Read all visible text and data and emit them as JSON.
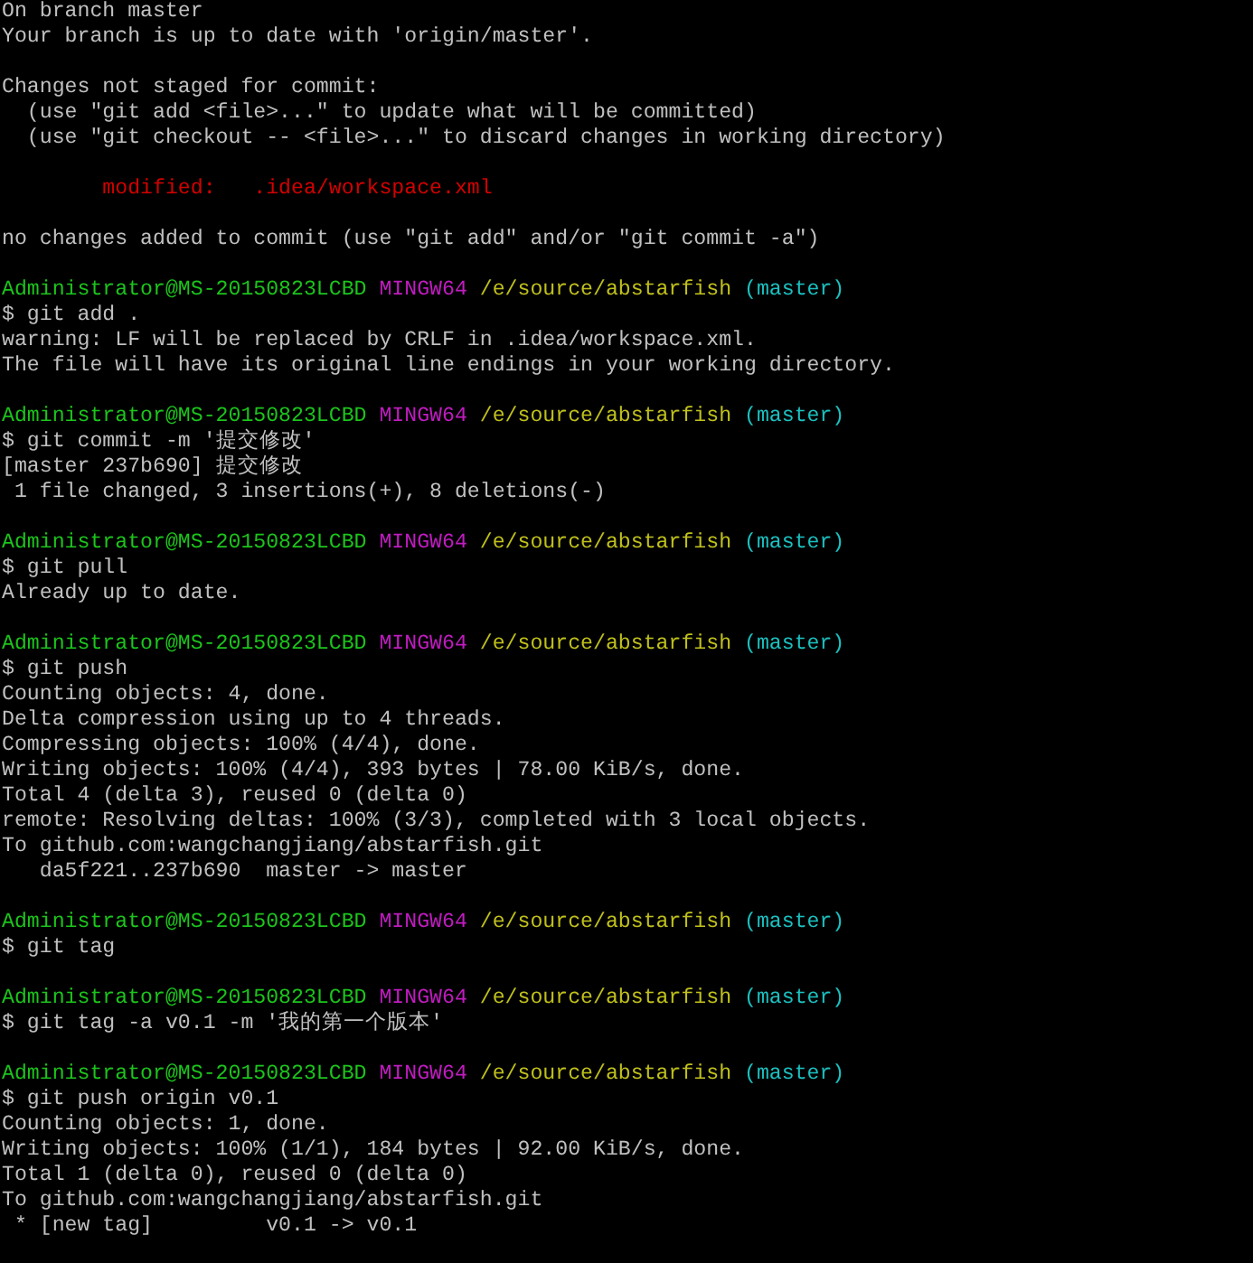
{
  "terminal": {
    "lines": [
      {
        "kind": "text",
        "text": "On branch master"
      },
      {
        "kind": "text",
        "text": "Your branch is up to date with 'origin/master'."
      },
      {
        "kind": "blank"
      },
      {
        "kind": "text",
        "text": "Changes not staged for commit:"
      },
      {
        "kind": "text",
        "text": "  (use \"git add <file>...\" to update what will be committed)"
      },
      {
        "kind": "text",
        "text": "  (use \"git checkout -- <file>...\" to discard changes in working directory)"
      },
      {
        "kind": "blank"
      },
      {
        "kind": "modified",
        "text": "modified:   .idea/workspace.xml"
      },
      {
        "kind": "blank"
      },
      {
        "kind": "text",
        "text": "no changes added to commit (use \"git add\" and/or \"git commit -a\")"
      },
      {
        "kind": "blank"
      },
      {
        "kind": "prompt",
        "user": "Administrator@MS-20150823LCBD",
        "system": "MINGW64",
        "path": "/e/source/abstarfish",
        "branch": "(master)"
      },
      {
        "kind": "text",
        "text": "$ git add ."
      },
      {
        "kind": "text",
        "text": "warning: LF will be replaced by CRLF in .idea/workspace.xml."
      },
      {
        "kind": "text",
        "text": "The file will have its original line endings in your working directory."
      },
      {
        "kind": "blank"
      },
      {
        "kind": "prompt",
        "user": "Administrator@MS-20150823LCBD",
        "system": "MINGW64",
        "path": "/e/source/abstarfish",
        "branch": "(master)"
      },
      {
        "kind": "text",
        "text": "$ git commit -m '提交修改'"
      },
      {
        "kind": "text",
        "text": "[master 237b690] 提交修改"
      },
      {
        "kind": "text",
        "text": " 1 file changed, 3 insertions(+), 8 deletions(-)"
      },
      {
        "kind": "blank"
      },
      {
        "kind": "prompt",
        "user": "Administrator@MS-20150823LCBD",
        "system": "MINGW64",
        "path": "/e/source/abstarfish",
        "branch": "(master)"
      },
      {
        "kind": "text",
        "text": "$ git pull"
      },
      {
        "kind": "text",
        "text": "Already up to date."
      },
      {
        "kind": "blank"
      },
      {
        "kind": "prompt",
        "user": "Administrator@MS-20150823LCBD",
        "system": "MINGW64",
        "path": "/e/source/abstarfish",
        "branch": "(master)"
      },
      {
        "kind": "text",
        "text": "$ git push"
      },
      {
        "kind": "text",
        "text": "Counting objects: 4, done."
      },
      {
        "kind": "text",
        "text": "Delta compression using up to 4 threads."
      },
      {
        "kind": "text",
        "text": "Compressing objects: 100% (4/4), done."
      },
      {
        "kind": "text",
        "text": "Writing objects: 100% (4/4), 393 bytes | 78.00 KiB/s, done."
      },
      {
        "kind": "text",
        "text": "Total 4 (delta 3), reused 0 (delta 0)"
      },
      {
        "kind": "text",
        "text": "remote: Resolving deltas: 100% (3/3), completed with 3 local objects."
      },
      {
        "kind": "text",
        "text": "To github.com:wangchangjiang/abstarfish.git"
      },
      {
        "kind": "text",
        "text": "   da5f221..237b690  master -> master"
      },
      {
        "kind": "blank"
      },
      {
        "kind": "prompt",
        "user": "Administrator@MS-20150823LCBD",
        "system": "MINGW64",
        "path": "/e/source/abstarfish",
        "branch": "(master)"
      },
      {
        "kind": "text",
        "text": "$ git tag"
      },
      {
        "kind": "blank"
      },
      {
        "kind": "prompt",
        "user": "Administrator@MS-20150823LCBD",
        "system": "MINGW64",
        "path": "/e/source/abstarfish",
        "branch": "(master)"
      },
      {
        "kind": "text",
        "text": "$ git tag -a v0.1 -m '我的第一个版本'"
      },
      {
        "kind": "blank"
      },
      {
        "kind": "prompt",
        "user": "Administrator@MS-20150823LCBD",
        "system": "MINGW64",
        "path": "/e/source/abstarfish",
        "branch": "(master)"
      },
      {
        "kind": "text",
        "text": "$ git push origin v0.1"
      },
      {
        "kind": "text",
        "text": "Counting objects: 1, done."
      },
      {
        "kind": "text",
        "text": "Writing objects: 100% (1/1), 184 bytes | 92.00 KiB/s, done."
      },
      {
        "kind": "text",
        "text": "Total 1 (delta 0), reused 0 (delta 0)"
      },
      {
        "kind": "text",
        "text": "To github.com:wangchangjiang/abstarfish.git"
      },
      {
        "kind": "text",
        "text": " * [new tag]         v0.1 -> v0.1"
      }
    ]
  }
}
